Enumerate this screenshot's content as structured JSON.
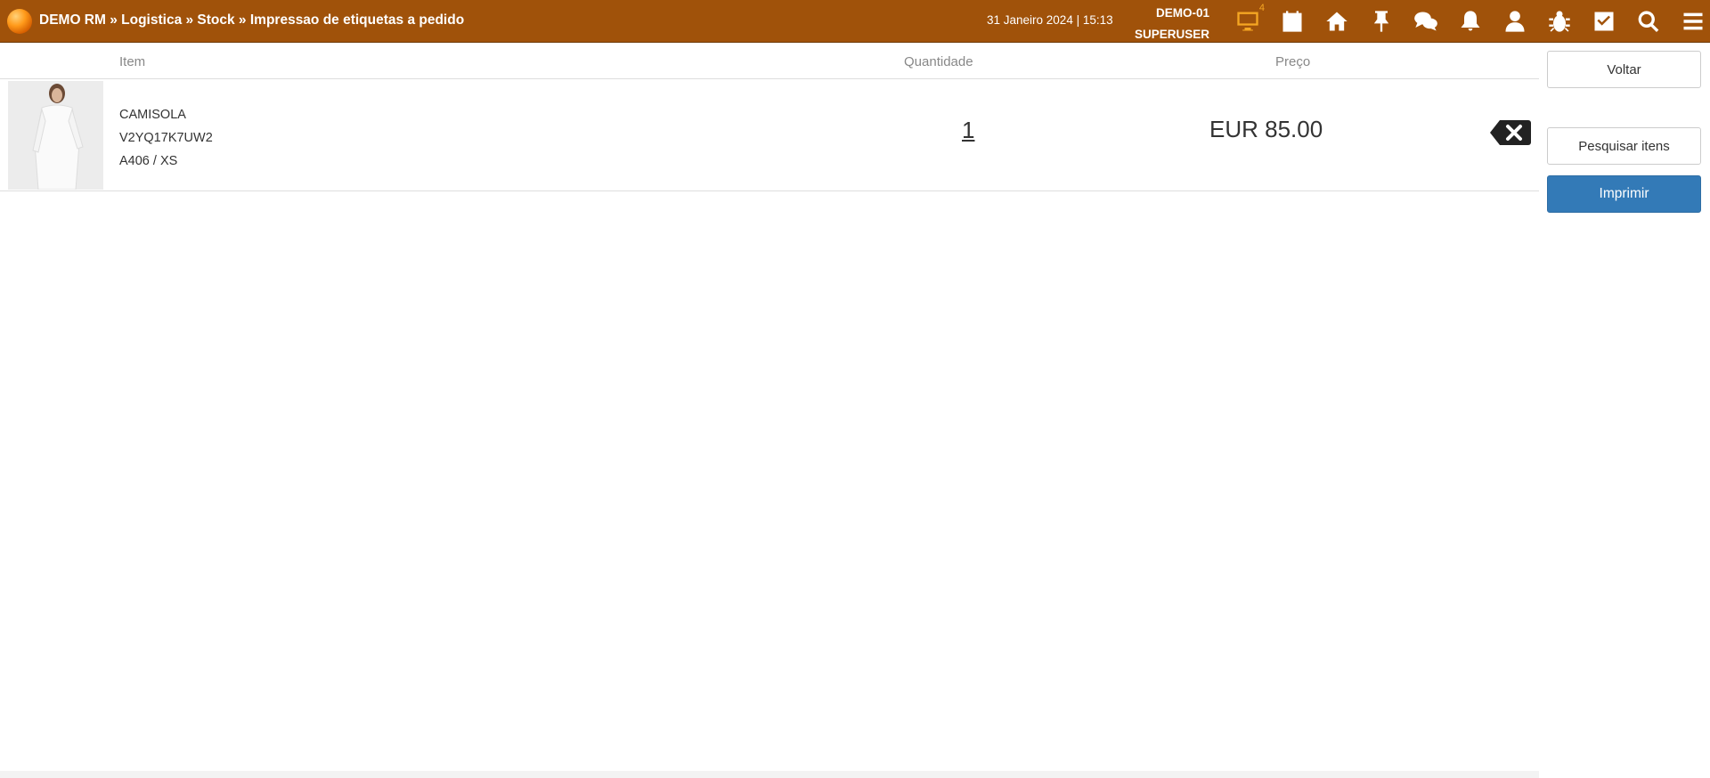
{
  "header": {
    "breadcrumb": "DEMO RM » Logistica » Stock » Impressao de etiquetas a pedido",
    "datetime": "31 Janeiro 2024 | 15:13",
    "terminal": "DEMO-01",
    "user": "SUPERUSER",
    "monitor_badge": "4",
    "icons": [
      "monitor-icon",
      "calendar-icon",
      "home-icon",
      "pin-icon",
      "chat-icon",
      "bell-icon",
      "user-icon",
      "bug-icon",
      "checkbox-icon",
      "search-icon",
      "menu-icon"
    ],
    "accent_color": "#a0520a"
  },
  "table": {
    "columns": {
      "item": "Item",
      "quantity": "Quantidade",
      "price": "Preço"
    },
    "rows": [
      {
        "name": "CAMISOLA",
        "code": "V2YQ17K7UW2",
        "variant": "A406 / XS",
        "quantity": "1",
        "price": "EUR 85.00"
      }
    ]
  },
  "actions": {
    "back": "Voltar",
    "search_items": "Pesquisar itens",
    "print": "Imprimir",
    "print_color": "#337ab7"
  }
}
